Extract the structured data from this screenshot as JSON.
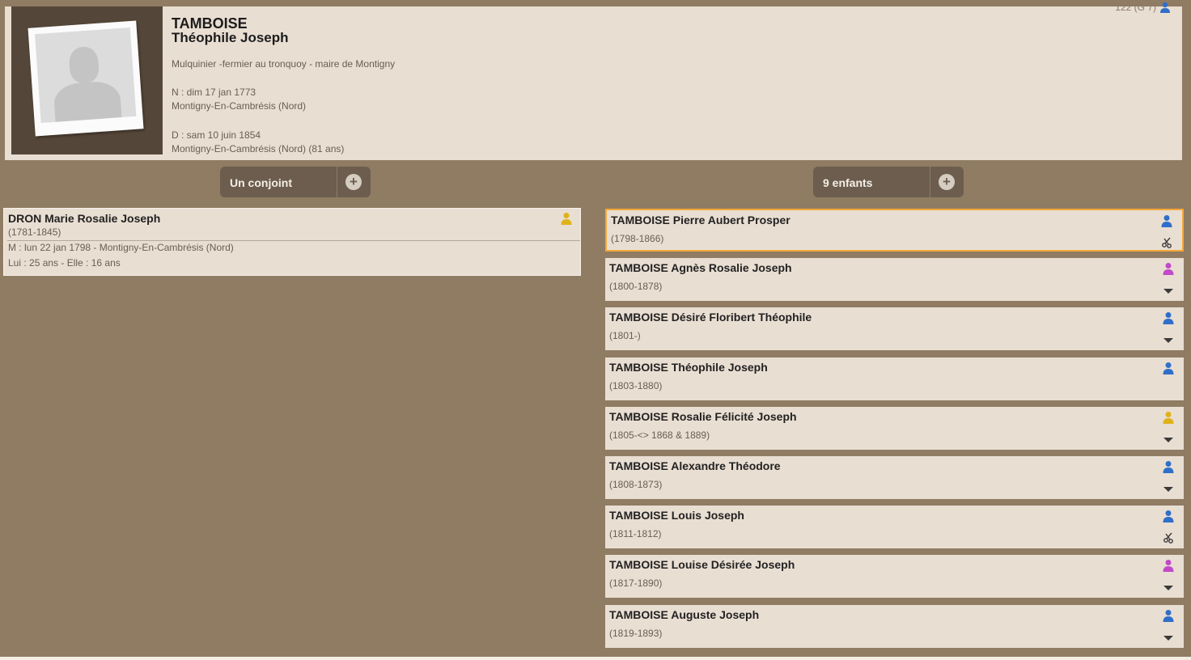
{
  "header": {
    "surname": "TAMBOISE",
    "given_names": "Théophile Joseph",
    "occupation": "Mulquinier -fermier au tronquoy - maire de Montigny",
    "birth_line": "N : dim 17 jan 1773",
    "birth_place": "Montigny-En-Cambrésis (Nord)",
    "death_line": "D : sam 10 juin 1854",
    "death_place": "Montigny-En-Cambrésis (Nord) (81 ans)",
    "sosa": "122 (G 7)",
    "sosa_icon": "person-blue-icon"
  },
  "spouse_toggle": {
    "label": "Un conjoint",
    "plus": "+"
  },
  "children_toggle": {
    "label": "9 enfants",
    "plus": "+"
  },
  "spouse": {
    "name": "DRON Marie Rosalie Joseph",
    "dates": "(1781-1845)",
    "marriage": "M : lun 22 jan 1798 - Montigny-En-Cambrésis (Nord)",
    "ages": "Lui : 25 ans - Elle : 16 ans",
    "icon": "person-yellow-icon"
  },
  "children": [
    {
      "name": "TAMBOISE Pierre Aubert Prosper",
      "dates": "(1798-1866)",
      "icon": "person-blue-icon",
      "action": "scissors-icon"
    },
    {
      "name": "TAMBOISE Agnès Rosalie Joseph",
      "dates": "(1800-1878)",
      "icon": "person-purple-icon",
      "action": "chevron-down-icon"
    },
    {
      "name": "TAMBOISE Désiré Floribert Théophile",
      "dates": "(1801-)",
      "icon": "person-blue-icon",
      "action": "chevron-down-icon"
    },
    {
      "name": "TAMBOISE Théophile Joseph",
      "dates": "(1803-1880)",
      "icon": "person-blue-icon",
      "action": ""
    },
    {
      "name": "TAMBOISE Rosalie Félicité Joseph",
      "dates": "(1805-<> 1868 & 1889)",
      "icon": "person-yellow-icon",
      "action": "chevron-down-icon"
    },
    {
      "name": "TAMBOISE Alexandre Théodore",
      "dates": "(1808-1873)",
      "icon": "person-blue-icon",
      "action": "chevron-down-icon"
    },
    {
      "name": "TAMBOISE Louis Joseph",
      "dates": "(1811-1812)",
      "icon": "person-blue-icon",
      "action": "scissors-icon"
    },
    {
      "name": "TAMBOISE Louise Désirée Joseph",
      "dates": "(1817-1890)",
      "icon": "person-purple-icon",
      "action": "chevron-down-icon"
    },
    {
      "name": "TAMBOISE Auguste Joseph",
      "dates": "(1819-1893)",
      "icon": "person-blue-icon",
      "action": "chevron-down-icon"
    }
  ],
  "colors": {
    "background": "#8f7c63",
    "card": "#e9ded2",
    "male": "#2f6fc9",
    "female": "#c04ac8",
    "unknown": "#e0b21a",
    "selected_border": "#f4a83a"
  }
}
